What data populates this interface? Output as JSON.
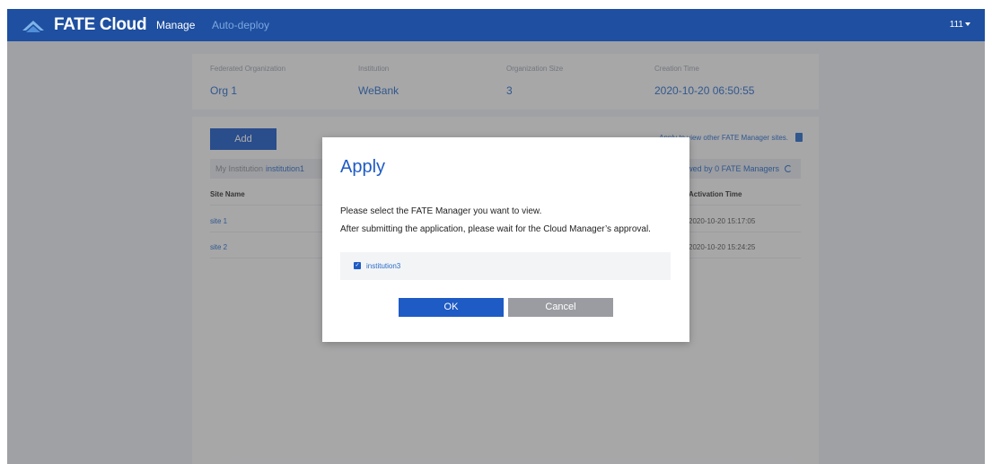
{
  "header": {
    "logo_text": "FATE Cloud",
    "nav": {
      "manage": "Manage",
      "auto_deploy": "Auto-deploy"
    },
    "user": "111"
  },
  "org_info": {
    "columns": [
      {
        "label": "Federated Organization",
        "value": "Org 1"
      },
      {
        "label": "Institution",
        "value": "WeBank"
      },
      {
        "label": "Organization Size",
        "value": "3"
      },
      {
        "label": "Creation Time",
        "value": "2020-10-20 06:50:55"
      }
    ]
  },
  "main": {
    "add_label": "Add",
    "apply_link": "Apply to view other FATE Manager sites.",
    "institution_label": "My Institution",
    "institution_name": "institution1",
    "viewby_text": "Viewed by  0  FATE Managers",
    "table": {
      "headers": {
        "site_name": "Site Name",
        "activation_time": "Activation Time"
      },
      "rows": [
        {
          "site_name": "site 1",
          "activation_time": "2020-10-20 15:17:05"
        },
        {
          "site_name": "site 2",
          "activation_time": "2020-10-20 15:24:25"
        }
      ]
    }
  },
  "dialog": {
    "title": "Apply",
    "text1": "Please select the FATE Manager you want to view.",
    "text2": "After submitting the application, please wait for the Cloud Manager’s approval.",
    "option": "institution3",
    "option_checked": true,
    "ok_label": "OK",
    "cancel_label": "Cancel"
  },
  "colors": {
    "header_bg": "#1e4fa0",
    "accent": "#1e5bc4",
    "cancel": "#9a9ca1"
  }
}
